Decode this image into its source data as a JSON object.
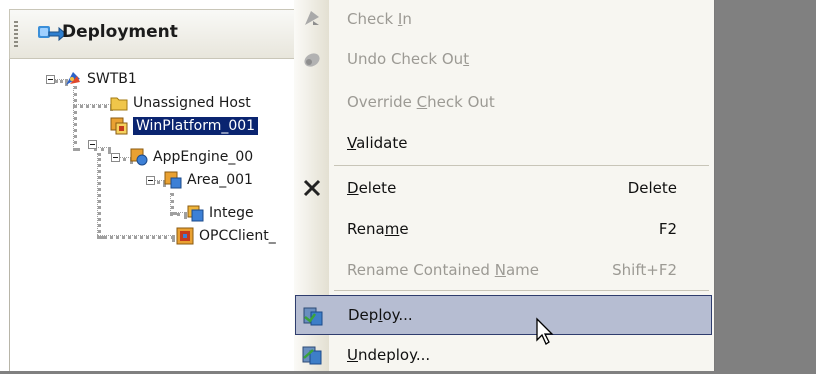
{
  "panel": {
    "title": "Deployment",
    "title_icon": "deployment-icon"
  },
  "tree": [
    {
      "label": "SWTB1",
      "icon": "galaxy-icon"
    },
    {
      "label": "Unassigned Host",
      "icon": "folder-icon"
    },
    {
      "label": "WinPlatform_001",
      "icon": "platform-icon",
      "selected": true
    },
    {
      "label": "AppEngine_00",
      "icon": "appengine-icon"
    },
    {
      "label": "Area_001",
      "icon": "area-icon"
    },
    {
      "label": "Intege",
      "icon": "object-icon"
    },
    {
      "label": "OPCClient_",
      "icon": "opcclient-icon"
    }
  ],
  "menu": {
    "items": [
      {
        "pre": "Check ",
        "acc": "I",
        "post": "n",
        "shortcut": "",
        "enabled": false,
        "icon": "check-in-icon"
      },
      {
        "pre": "Undo Check Ou",
        "acc": "t",
        "post": "",
        "shortcut": "",
        "enabled": false,
        "icon": "undo-check-out-icon"
      },
      {
        "pre": "Override ",
        "acc": "C",
        "post": "heck Out",
        "shortcut": "",
        "enabled": false,
        "icon": ""
      },
      {
        "pre": "",
        "acc": "V",
        "post": "alidate",
        "shortcut": "",
        "enabled": true,
        "icon": ""
      },
      {
        "pre": "",
        "acc": "D",
        "post": "elete",
        "shortcut": "Delete",
        "enabled": true,
        "icon": "delete-icon"
      },
      {
        "pre": "Rena",
        "acc": "m",
        "post": "e",
        "shortcut": "F2",
        "enabled": true,
        "icon": ""
      },
      {
        "pre": "Rename Contained ",
        "acc": "N",
        "post": "ame",
        "shortcut": "Shift+F2",
        "enabled": false,
        "icon": ""
      },
      {
        "pre": "Dep",
        "acc": "l",
        "post": "oy...",
        "shortcut": "",
        "enabled": true,
        "icon": "deploy-icon",
        "highlighted": true
      },
      {
        "pre": "",
        "acc": "U",
        "post": "ndeploy...",
        "shortcut": "",
        "enabled": true,
        "icon": "undeploy-icon"
      }
    ]
  },
  "colors": {
    "selection": "#0a2470",
    "menu_highlight": "#b6bdd2",
    "menu_background": "#f7f6f1",
    "desktop": "#808080"
  }
}
